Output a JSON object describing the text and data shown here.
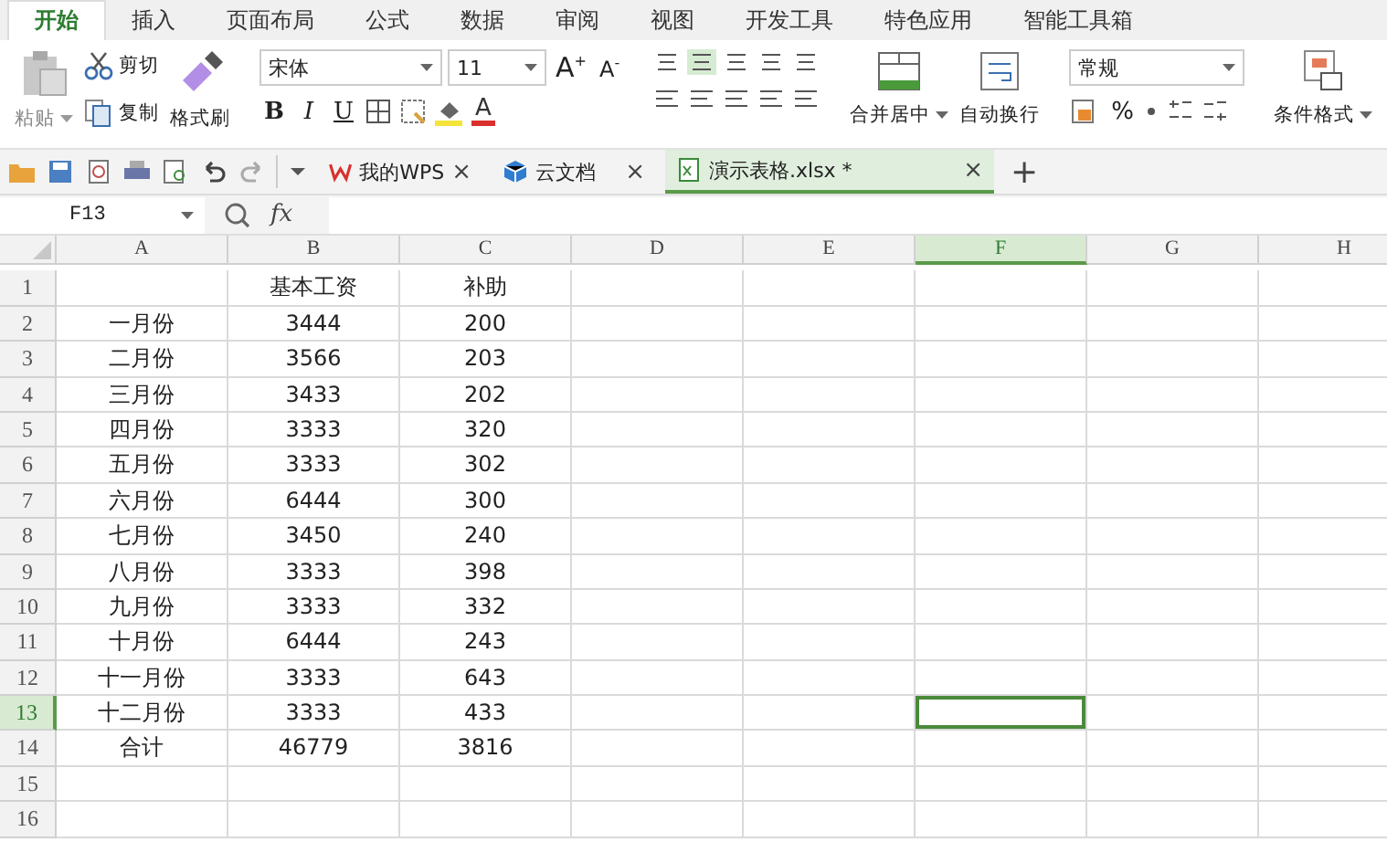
{
  "menu_tabs": [
    {
      "label": "开始",
      "selected": true
    },
    {
      "label": "插入",
      "selected": false
    },
    {
      "label": "页面布局",
      "selected": false
    },
    {
      "label": "公式",
      "selected": false
    },
    {
      "label": "数据",
      "selected": false
    },
    {
      "label": "审阅",
      "selected": false
    },
    {
      "label": "视图",
      "selected": false
    },
    {
      "label": "开发工具",
      "selected": false
    },
    {
      "label": "特色应用",
      "selected": false
    },
    {
      "label": "智能工具箱",
      "selected": false
    }
  ],
  "clipboard": {
    "paste": "粘贴",
    "cut": "剪切",
    "copy": "复制",
    "format_painter": "格式刷"
  },
  "font": {
    "name": "宋体",
    "size": "11",
    "grow": "A$^{+}$",
    "shrink": "A$^{-}$",
    "font_color": "A"
  },
  "format_buttons": [
    {
      "kind": "bold",
      "label": "B"
    },
    {
      "kind": "italic",
      "label": "I"
    },
    {
      "kind": "underline",
      "label": "U"
    }
  ],
  "merge": {
    "label": "合并居中"
  },
  "wrap": {
    "label": "自动换行"
  },
  "number_format": {
    "value": "常规",
    "percent": "%"
  },
  "conditional_format": {
    "label": "条件格式"
  },
  "doc_tabs": [
    {
      "kind": "wps",
      "label": "我的WPS",
      "close": "×",
      "selected": false
    },
    {
      "kind": "cloud",
      "label": "云文档",
      "close": "×",
      "selected": false
    },
    {
      "kind": "sheet",
      "label": "演示表格.xlsx *",
      "close": "×",
      "selected": true
    }
  ],
  "new_tab": "+",
  "name_box": "F13",
  "formula_label": "fx",
  "columns": [
    {
      "label": "A",
      "selected": false
    },
    {
      "label": "B",
      "selected": false
    },
    {
      "label": "C",
      "selected": false
    },
    {
      "label": "D",
      "selected": false
    },
    {
      "label": "E",
      "selected": false
    },
    {
      "label": "F",
      "selected": true
    },
    {
      "label": "G",
      "selected": false
    },
    {
      "label": "H",
      "selected": false
    }
  ],
  "rows": [
    {
      "number": "1",
      "selected": false,
      "cells": {
        "B": "基本工资",
        "C": "补助"
      }
    },
    {
      "number": "2",
      "selected": false,
      "cells": {
        "A": "一月份",
        "B": "3444",
        "C": "200"
      }
    },
    {
      "number": "3",
      "selected": false,
      "cells": {
        "A": "二月份",
        "B": "3566",
        "C": "203"
      }
    },
    {
      "number": "4",
      "selected": false,
      "cells": {
        "A": "三月份",
        "B": "3433",
        "C": "202"
      }
    },
    {
      "number": "5",
      "selected": false,
      "cells": {
        "A": "四月份",
        "B": "3333",
        "C": "320"
      }
    },
    {
      "number": "6",
      "selected": false,
      "cells": {
        "A": "五月份",
        "B": "3333",
        "C": "302"
      }
    },
    {
      "number": "7",
      "selected": false,
      "cells": {
        "A": "六月份",
        "B": "6444",
        "C": "300"
      }
    },
    {
      "number": "8",
      "selected": false,
      "cells": {
        "A": "七月份",
        "B": "3450",
        "C": "240"
      }
    },
    {
      "number": "9",
      "selected": false,
      "cells": {
        "A": "八月份",
        "B": "3333",
        "C": "398"
      }
    },
    {
      "number": "10",
      "selected": false,
      "cells": {
        "A": "九月份",
        "B": "3333",
        "C": "332"
      }
    },
    {
      "number": "11",
      "selected": false,
      "cells": {
        "A": "十月份",
        "B": "6444",
        "C": "243"
      }
    },
    {
      "number": "12",
      "selected": false,
      "cells": {
        "A": "十一月份",
        "B": "3333",
        "C": "643"
      }
    },
    {
      "number": "13",
      "selected": true,
      "cells": {
        "A": "十二月份",
        "B": "3333",
        "C": "433"
      }
    },
    {
      "number": "14",
      "selected": false,
      "cells": {
        "A": "合计",
        "B": "46779",
        "C": "3816"
      }
    },
    {
      "number": "15",
      "selected": false,
      "cells": {}
    },
    {
      "number": "16",
      "selected": false,
      "cells": {}
    }
  ]
}
